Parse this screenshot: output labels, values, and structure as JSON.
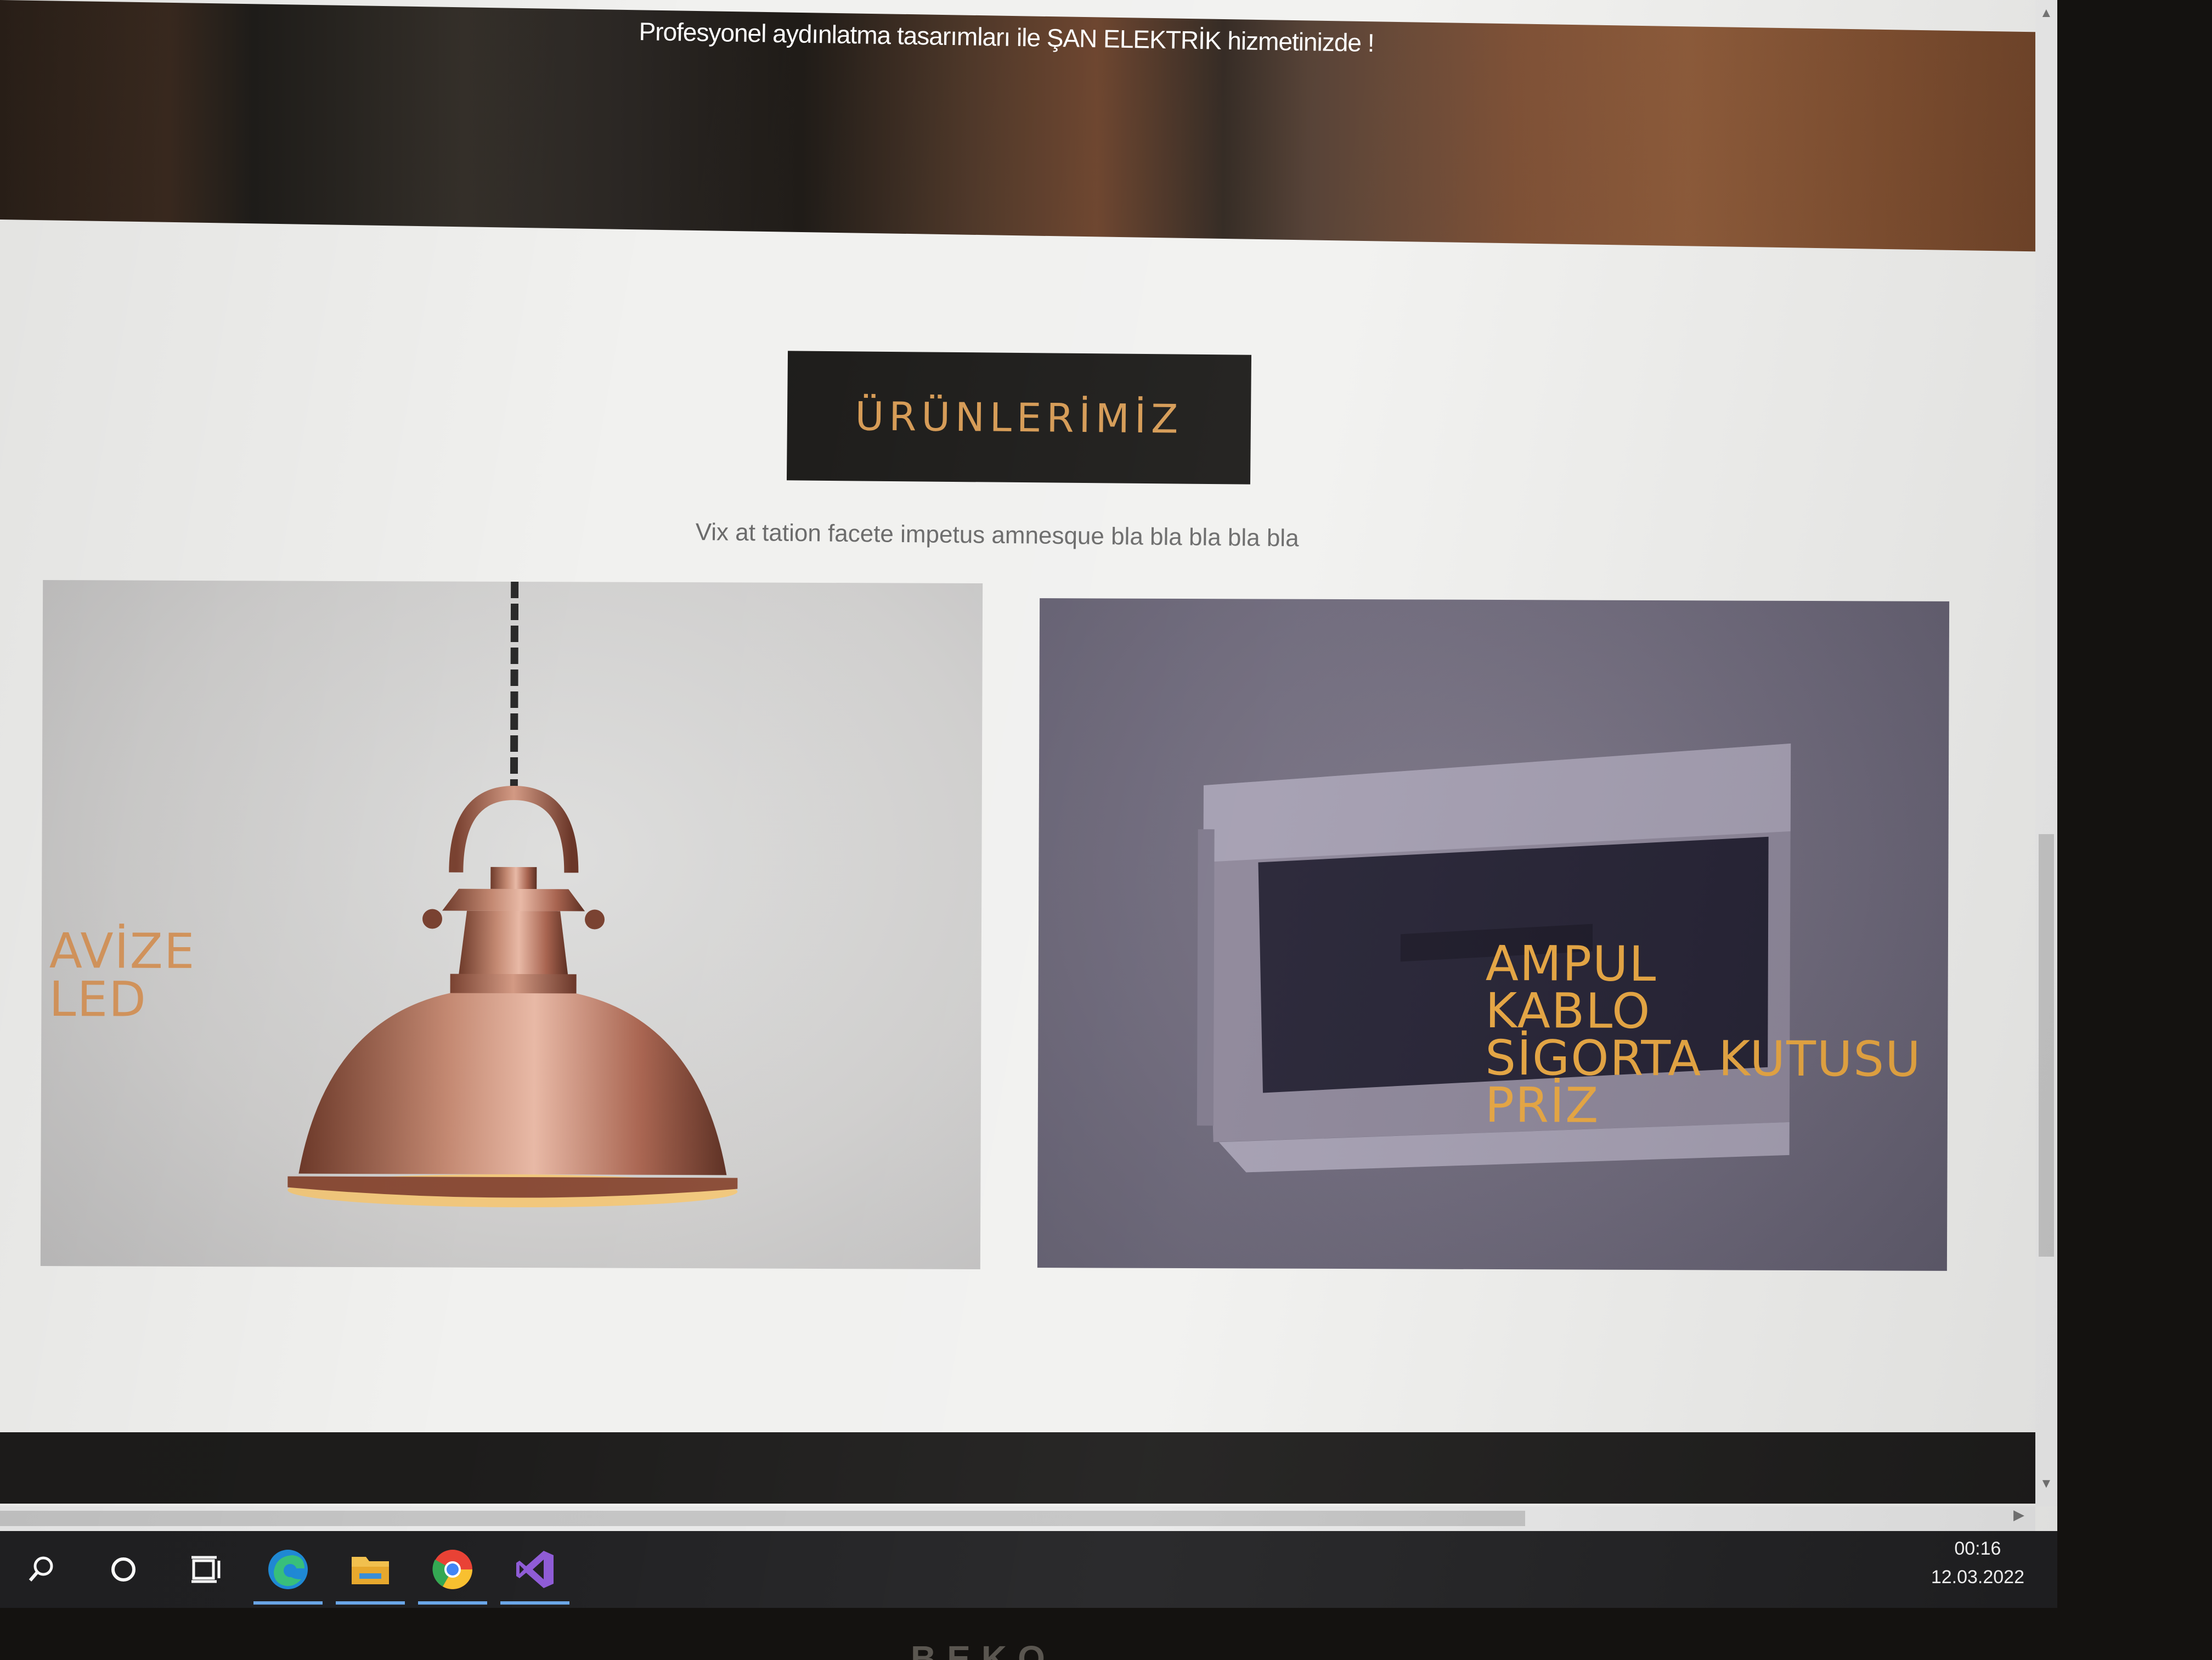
{
  "hero": {
    "subtitle": "Profesyonel aydınlatma tasarımları ile ŞAN ELEKTRİK hizmetinizde !"
  },
  "products": {
    "heading": "ÜRÜNLERİMİZ",
    "subtitle": "Vix at tation facete impetus amnesque bla bla bla bla bla",
    "cards": [
      {
        "labels": [
          "AVİZE",
          "LED"
        ]
      },
      {
        "labels": [
          "AMPUL",
          "KABLO",
          "SİGORTA KUTUSU",
          "PRİZ"
        ]
      }
    ]
  },
  "taskbar": {
    "icons": [
      "search-icon",
      "cortana-icon",
      "task-view-icon",
      "edge-icon",
      "file-explorer-icon",
      "chrome-icon",
      "visual-studio-icon"
    ],
    "time": "00:16",
    "date": "12.03.2022"
  },
  "colors": {
    "accent": "#d59a54",
    "dark_band": "#1c1b19",
    "page_bg": "#f1f1ef"
  }
}
